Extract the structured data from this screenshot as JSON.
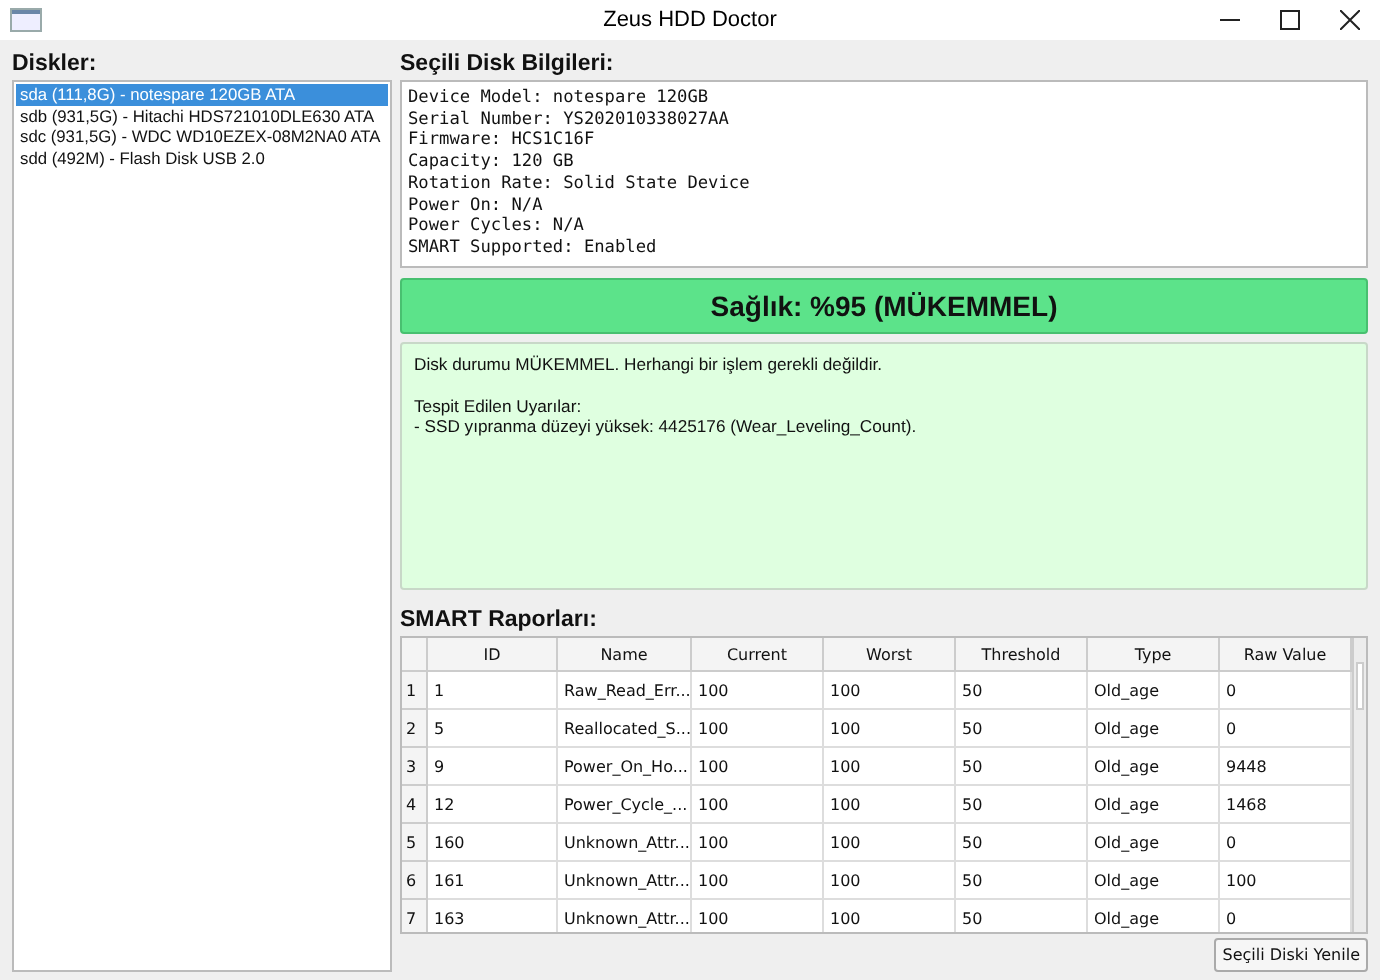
{
  "window": {
    "title": "Zeus HDD Doctor"
  },
  "disks": {
    "heading": "Diskler:",
    "items": [
      {
        "label": "sda (111,8G) - notespare 120GB ATA",
        "selected": true
      },
      {
        "label": "sdb (931,5G) - Hitachi HDS721010DLE630 ATA",
        "selected": false
      },
      {
        "label": "sdc (931,5G) - WDC WD10EZEX-08M2NA0 ATA",
        "selected": false
      },
      {
        "label": "sdd (492M) - Flash Disk USB 2.0",
        "selected": false
      }
    ]
  },
  "info": {
    "heading": "Seçili Disk Bilgileri:",
    "lines": [
      "Device Model: notespare 120GB",
      "Serial Number: YS202010338027AA",
      "Firmware: HCS1C16F",
      "Capacity: 120 GB",
      "Rotation Rate: Solid State Device",
      "Power On: N/A",
      "Power Cycles: N/A",
      "SMART Supported: Enabled"
    ]
  },
  "health": {
    "label": "Sağlık: %95 (MÜKEMMEL)",
    "color": "#5ce38a"
  },
  "message": {
    "summary": "Disk durumu MÜKEMMEL. Herhangi bir işlem gerekli değildir.",
    "warnings_heading": "Tespit Edilen Uyarılar:",
    "warnings": [
      "- SSD yıpranma düzeyi yüksek: 4425176 (Wear_Leveling_Count)."
    ]
  },
  "smart": {
    "heading": "SMART Raporları:",
    "columns": [
      "ID",
      "Name",
      "Current",
      "Worst",
      "Threshold",
      "Type",
      "Raw Value"
    ],
    "rows": [
      {
        "number": "1",
        "cells": [
          "1",
          "Raw_Read_Err...",
          "100",
          "100",
          "50",
          "Old_age",
          "0"
        ]
      },
      {
        "number": "2",
        "cells": [
          "5",
          "Reallocated_S...",
          "100",
          "100",
          "50",
          "Old_age",
          "0"
        ]
      },
      {
        "number": "3",
        "cells": [
          "9",
          "Power_On_Ho...",
          "100",
          "100",
          "50",
          "Old_age",
          "9448"
        ]
      },
      {
        "number": "4",
        "cells": [
          "12",
          "Power_Cycle_...",
          "100",
          "100",
          "50",
          "Old_age",
          "1468"
        ]
      },
      {
        "number": "5",
        "cells": [
          "160",
          "Unknown_Attr...",
          "100",
          "100",
          "50",
          "Old_age",
          "0"
        ]
      },
      {
        "number": "6",
        "cells": [
          "161",
          "Unknown_Attr...",
          "100",
          "100",
          "50",
          "Old_age",
          "100"
        ]
      },
      {
        "number": "7",
        "cells": [
          "163",
          "Unknown_Attr...",
          "100",
          "100",
          "50",
          "Old_age",
          "0"
        ]
      }
    ]
  },
  "refresh_button": "Seçili Diski Yenile"
}
